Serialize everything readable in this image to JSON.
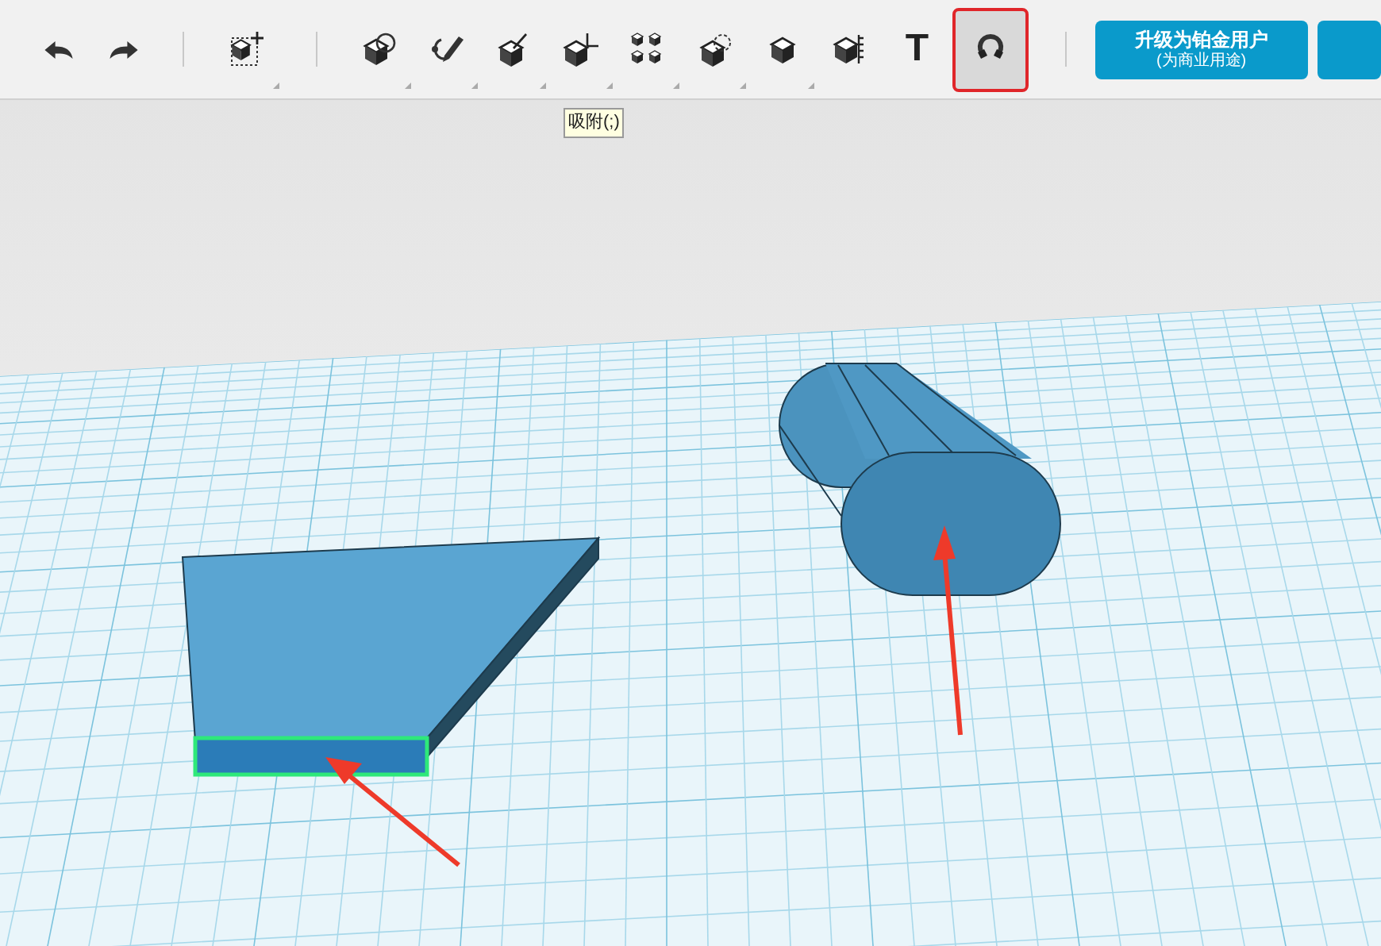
{
  "toolbar": {
    "history": [
      {
        "kind": "undo"
      },
      {
        "kind": "redo"
      }
    ],
    "tools": [
      {
        "kind": "move",
        "dropdown": true,
        "selected": false,
        "group_start": true
      },
      {
        "kind": "shape",
        "dropdown": true,
        "selected": false,
        "group_start": true
      },
      {
        "kind": "sketch",
        "dropdown": true,
        "selected": false,
        "group_start": false
      },
      {
        "kind": "modify",
        "dropdown": true,
        "selected": false,
        "group_start": false
      },
      {
        "kind": "transform",
        "dropdown": true,
        "selected": false,
        "group_start": false
      },
      {
        "kind": "pattern",
        "dropdown": true,
        "selected": false,
        "group_start": false
      },
      {
        "kind": "combine",
        "dropdown": true,
        "selected": false,
        "group_start": false
      },
      {
        "kind": "material",
        "dropdown": true,
        "selected": false,
        "group_start": false
      },
      {
        "kind": "measure",
        "dropdown": false,
        "selected": false,
        "group_start": false
      },
      {
        "kind": "text",
        "label": "T",
        "dropdown": false,
        "selected": false,
        "group_start": false
      },
      {
        "kind": "snap",
        "dropdown": false,
        "selected": true,
        "group_start": false
      }
    ],
    "tooltip": "吸附(;)",
    "upgrade_button": {
      "title": "升级为铂金用户",
      "subtitle": "(为商业用途)"
    }
  }
}
